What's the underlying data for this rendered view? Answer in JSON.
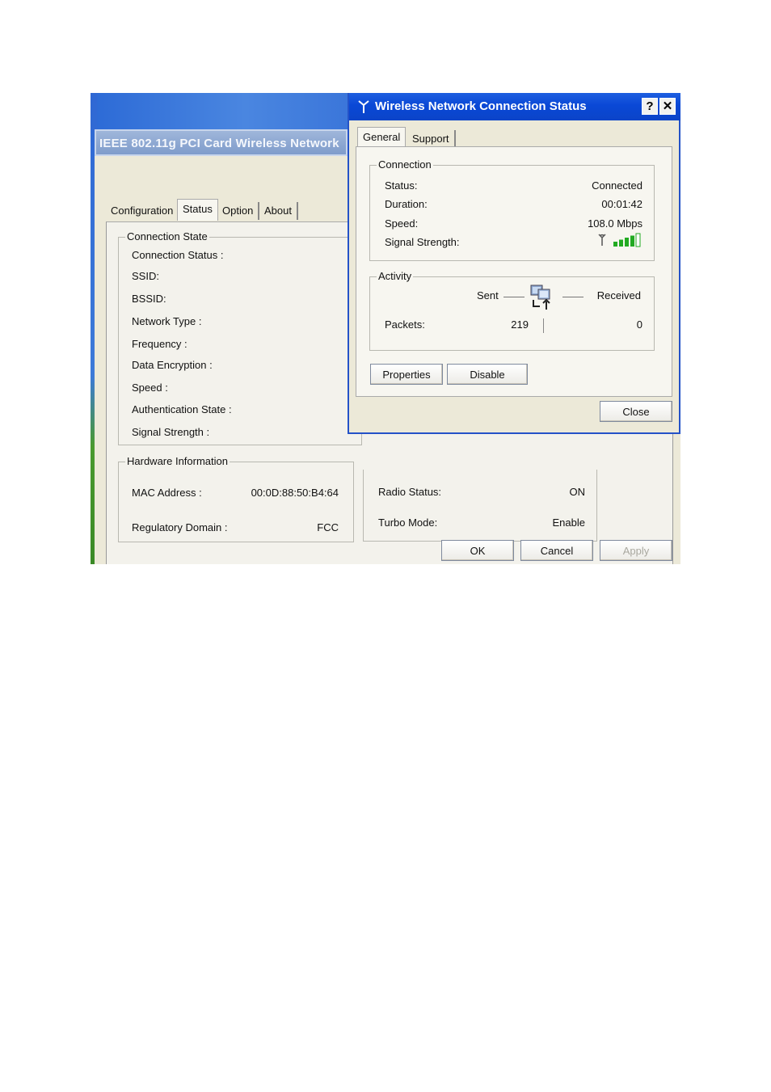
{
  "back_window": {
    "title": "IEEE 802.11g PCI Card Wireless Network",
    "tabs": [
      "Configuration",
      "Status",
      "Option",
      "About"
    ],
    "connection_state": {
      "legend": "Connection State",
      "rows": [
        "Connection Status :",
        "SSID:",
        "BSSID:",
        "Network Type :",
        "Frequency :",
        "Data Encryption :",
        "Speed :",
        "Authentication State :",
        "Signal Strength :"
      ]
    },
    "hardware": {
      "legend": "Hardware Information",
      "mac_label": "MAC Address :",
      "mac_value": "00:0D:88:50:B4:64",
      "domain_label": "Regulatory Domain :",
      "domain_value": "FCC",
      "radio_label": "Radio Status:",
      "radio_value": "ON",
      "turbo_label": "Turbo Mode:",
      "turbo_value": "Enable"
    },
    "buttons": {
      "ok": "OK",
      "cancel": "Cancel",
      "apply": "Apply"
    }
  },
  "dialog": {
    "title": "Wireless Network Connection Status",
    "help": "?",
    "close_x": "✕",
    "tabs": [
      "General",
      "Support"
    ],
    "connection": {
      "legend": "Connection",
      "status_label": "Status:",
      "status_value": "Connected",
      "duration_label": "Duration:",
      "duration_value": "00:01:42",
      "speed_label": "Speed:",
      "speed_value": "108.0 Mbps",
      "signal_label": "Signal Strength:",
      "signal_bars": 4,
      "signal_bars_total": 5
    },
    "activity": {
      "legend": "Activity",
      "sent_label": "Sent",
      "received_label": "Received",
      "packets_label": "Packets:",
      "packets_sent": "219",
      "packets_received": "0"
    },
    "buttons": {
      "properties": "Properties",
      "disable": "Disable",
      "close": "Close"
    }
  },
  "colors": {
    "titlebar": "#0a48d6",
    "signal": "#22aa22",
    "face": "#ece9d8"
  }
}
